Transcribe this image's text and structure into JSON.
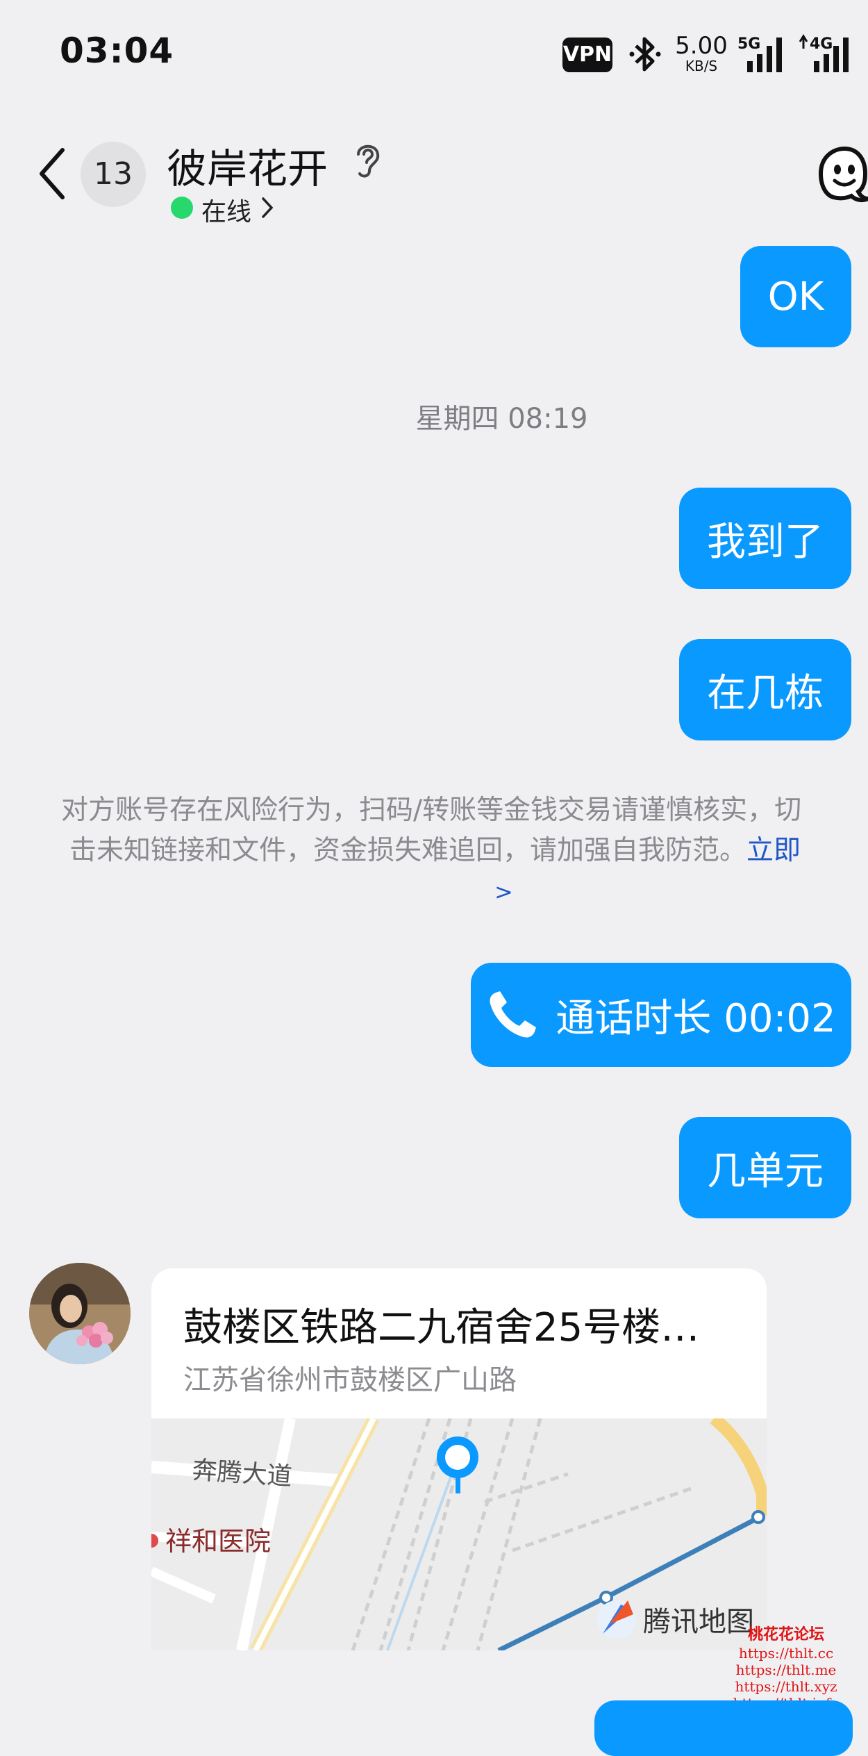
{
  "status_bar": {
    "time": "03:04",
    "vpn": "VPN",
    "speed_value": "5.00",
    "speed_unit": "KB/S",
    "network_5g": "5G",
    "network_4g": "4G"
  },
  "header": {
    "unread_count": "13",
    "contact_name": "彼岸花开",
    "status": "在线",
    "status_color": "#27d86d"
  },
  "messages": {
    "ok": "OK",
    "timestamp": "星期四 08:19",
    "arrived": "我到了",
    "which_building": "在几栋",
    "risk_notice_line1": "对方账号存在风险行为，扫码/转账等金钱交易请谨慎核实，切",
    "risk_notice_line2": "击未知链接和文件，资金损失难追回，请加强自我防范。",
    "risk_notice_link": "立即",
    "risk_notice_chevron": ">",
    "call_duration": "通话时长 00:02",
    "which_unit": "几单元"
  },
  "location_card": {
    "title": "鼓楼区铁路二九宿舍25号楼…",
    "address": "江苏省徐州市鼓楼区广山路",
    "map_label_road": "奔腾大道",
    "map_label_hospital": "祥和医院",
    "map_provider": "腾讯地图"
  },
  "watermark": {
    "title": "桃花花论坛",
    "urls": [
      "https://thlt.cc",
      "https://thlt.me",
      "https://thlt.xyz",
      "https://thlt.info"
    ]
  },
  "colors": {
    "accent": "#0a99ff",
    "background": "#f0f0f3",
    "link": "#1f57c8",
    "watermark": "#e01414"
  }
}
